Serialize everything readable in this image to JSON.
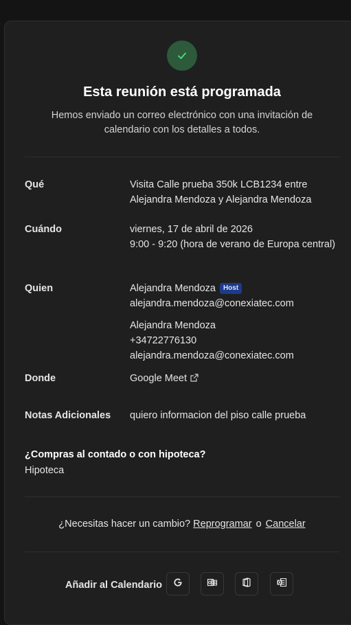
{
  "header": {
    "title": "Esta reunión está programada",
    "subtitle": "Hemos enviado un correo electrónico con una invitación de calendario con los detalles a todos."
  },
  "details": {
    "what": {
      "label": "Qué",
      "value": "Visita Calle prueba 350k LCB1234 entre Alejandra Mendoza y Alejandra Mendoza"
    },
    "when": {
      "label": "Cuándo",
      "date": "viernes, 17 de abril de 2026",
      "time": "9:00 - 9:20 (hora de verano de Europa central)"
    },
    "who": {
      "label": "Quien",
      "attendees": [
        {
          "name": "Alejandra Mendoza",
          "badge": "Host",
          "email": "alejandra.mendoza@conexiatec.com"
        },
        {
          "name": "Alejandra Mendoza",
          "phone": "+34722776130",
          "email": "alejandra.mendoza@conexiatec.com"
        }
      ]
    },
    "where": {
      "label": "Donde",
      "value": "Google Meet"
    },
    "notes": {
      "label": "Notas Adicionales",
      "value": "quiero informacion del piso calle prueba"
    }
  },
  "extra": {
    "question": "¿Compras al contado o con hipoteca?",
    "answer": "Hipoteca"
  },
  "change": {
    "prompt": "¿Necesitas hacer un cambio?",
    "reschedule": "Reprogramar",
    "separator": "o",
    "cancel": "Cancelar"
  },
  "calendar": {
    "label": "Añadir al Calendario",
    "providers": [
      "google-calendar-icon",
      "outlook-calendar-icon",
      "office365-calendar-icon",
      "ics-calendar-icon"
    ]
  },
  "colors": {
    "background": "#141414",
    "card": "#1f1f1f",
    "success_circle": "#2d5a3a",
    "success_check": "#4ade80",
    "host_badge": "#1e3a8a"
  }
}
